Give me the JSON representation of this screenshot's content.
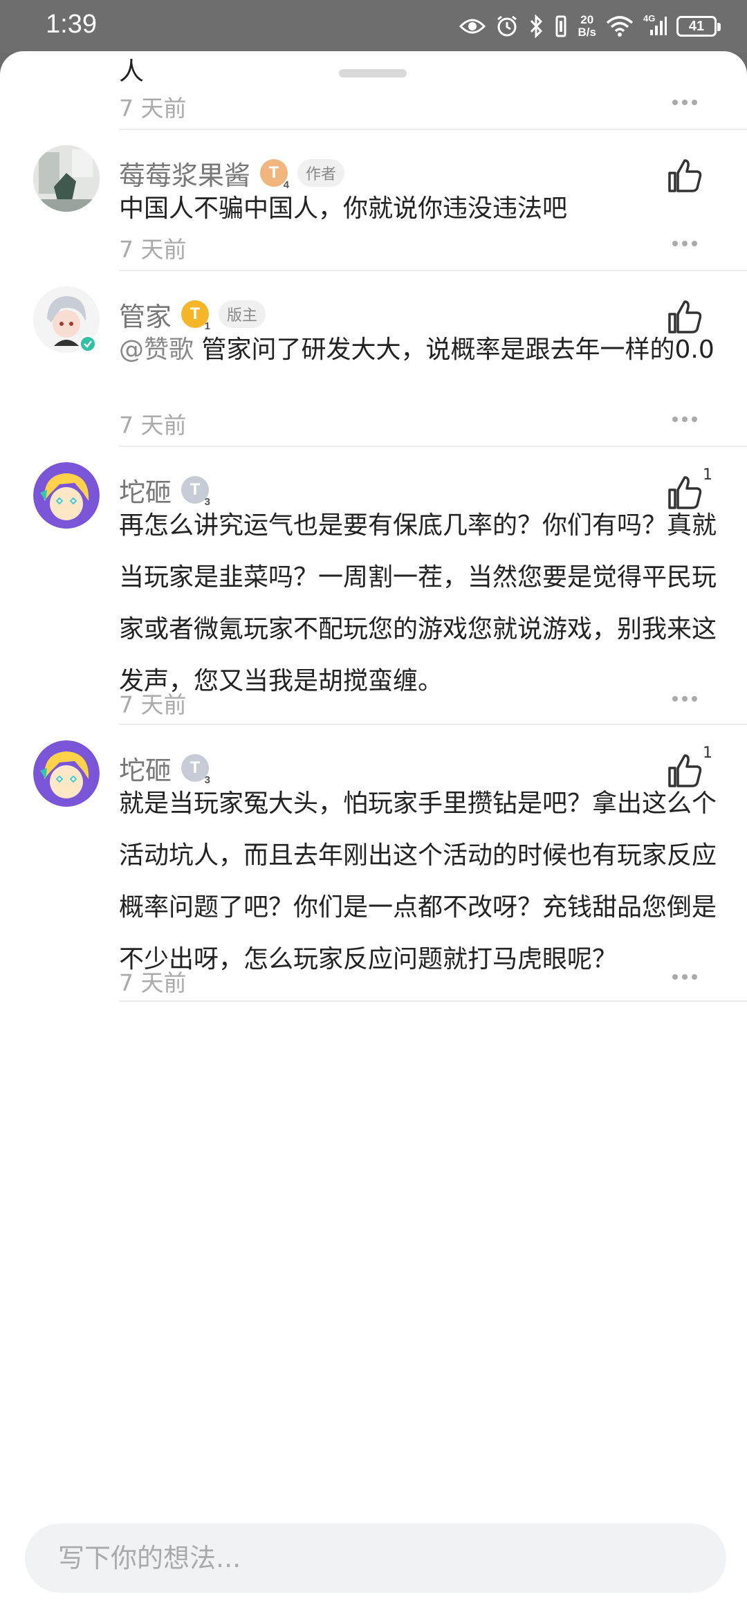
{
  "status": {
    "time": "1:39",
    "speed_value": "20",
    "speed_unit": "B/s",
    "network": "4G",
    "battery": "41"
  },
  "comments": [
    {
      "text_tail": "人",
      "time": "7 天前"
    },
    {
      "name": "莓莓浆果酱",
      "level": "T",
      "level_sub": "4",
      "tag": "作者",
      "text": "中国人不骗中国人，你就说你违没违法吧",
      "time": "7 天前"
    },
    {
      "name": "管家",
      "level": "T",
      "level_sub": "1",
      "tag": "版主",
      "mention": "@赞歌",
      "text": "管家问了研发大大，说概率是跟去年一样的0.0",
      "time": "7 天前"
    },
    {
      "name": "坨砸",
      "level": "T",
      "level_sub": "3",
      "likes": "1",
      "text": "再怎么讲究运气也是要有保底几率的？你们有吗？真就当玩家是韭菜吗？一周割一茬，当然您要是觉得平民玩家或者微氪玩家不配玩您的游戏您就说游戏，别我来这发声，您又当我是胡搅蛮缠。",
      "time": "7 天前"
    },
    {
      "name": "坨砸",
      "level": "T",
      "level_sub": "3",
      "likes": "1",
      "text": "就是当玩家冤大头，怕玩家手里攒钻是吧？拿出这么个活动坑人，而且去年刚出这个活动的时候也有玩家反应概率问题了吧？你们是一点都不改呀？充钱甜品您倒是不少出呀，怎么玩家反应问题就打马虎眼呢？",
      "time": "7 天前"
    }
  ],
  "input": {
    "placeholder": "写下你的想法..."
  },
  "icons": {
    "eye": "eye-icon",
    "alarm": "alarm-icon",
    "bluetooth": "bluetooth-icon",
    "vibrate": "vibrate-icon",
    "wifi": "wifi-icon",
    "signal": "signal-icon",
    "like": "thumbs-up-icon",
    "more": "more-dots-icon"
  }
}
